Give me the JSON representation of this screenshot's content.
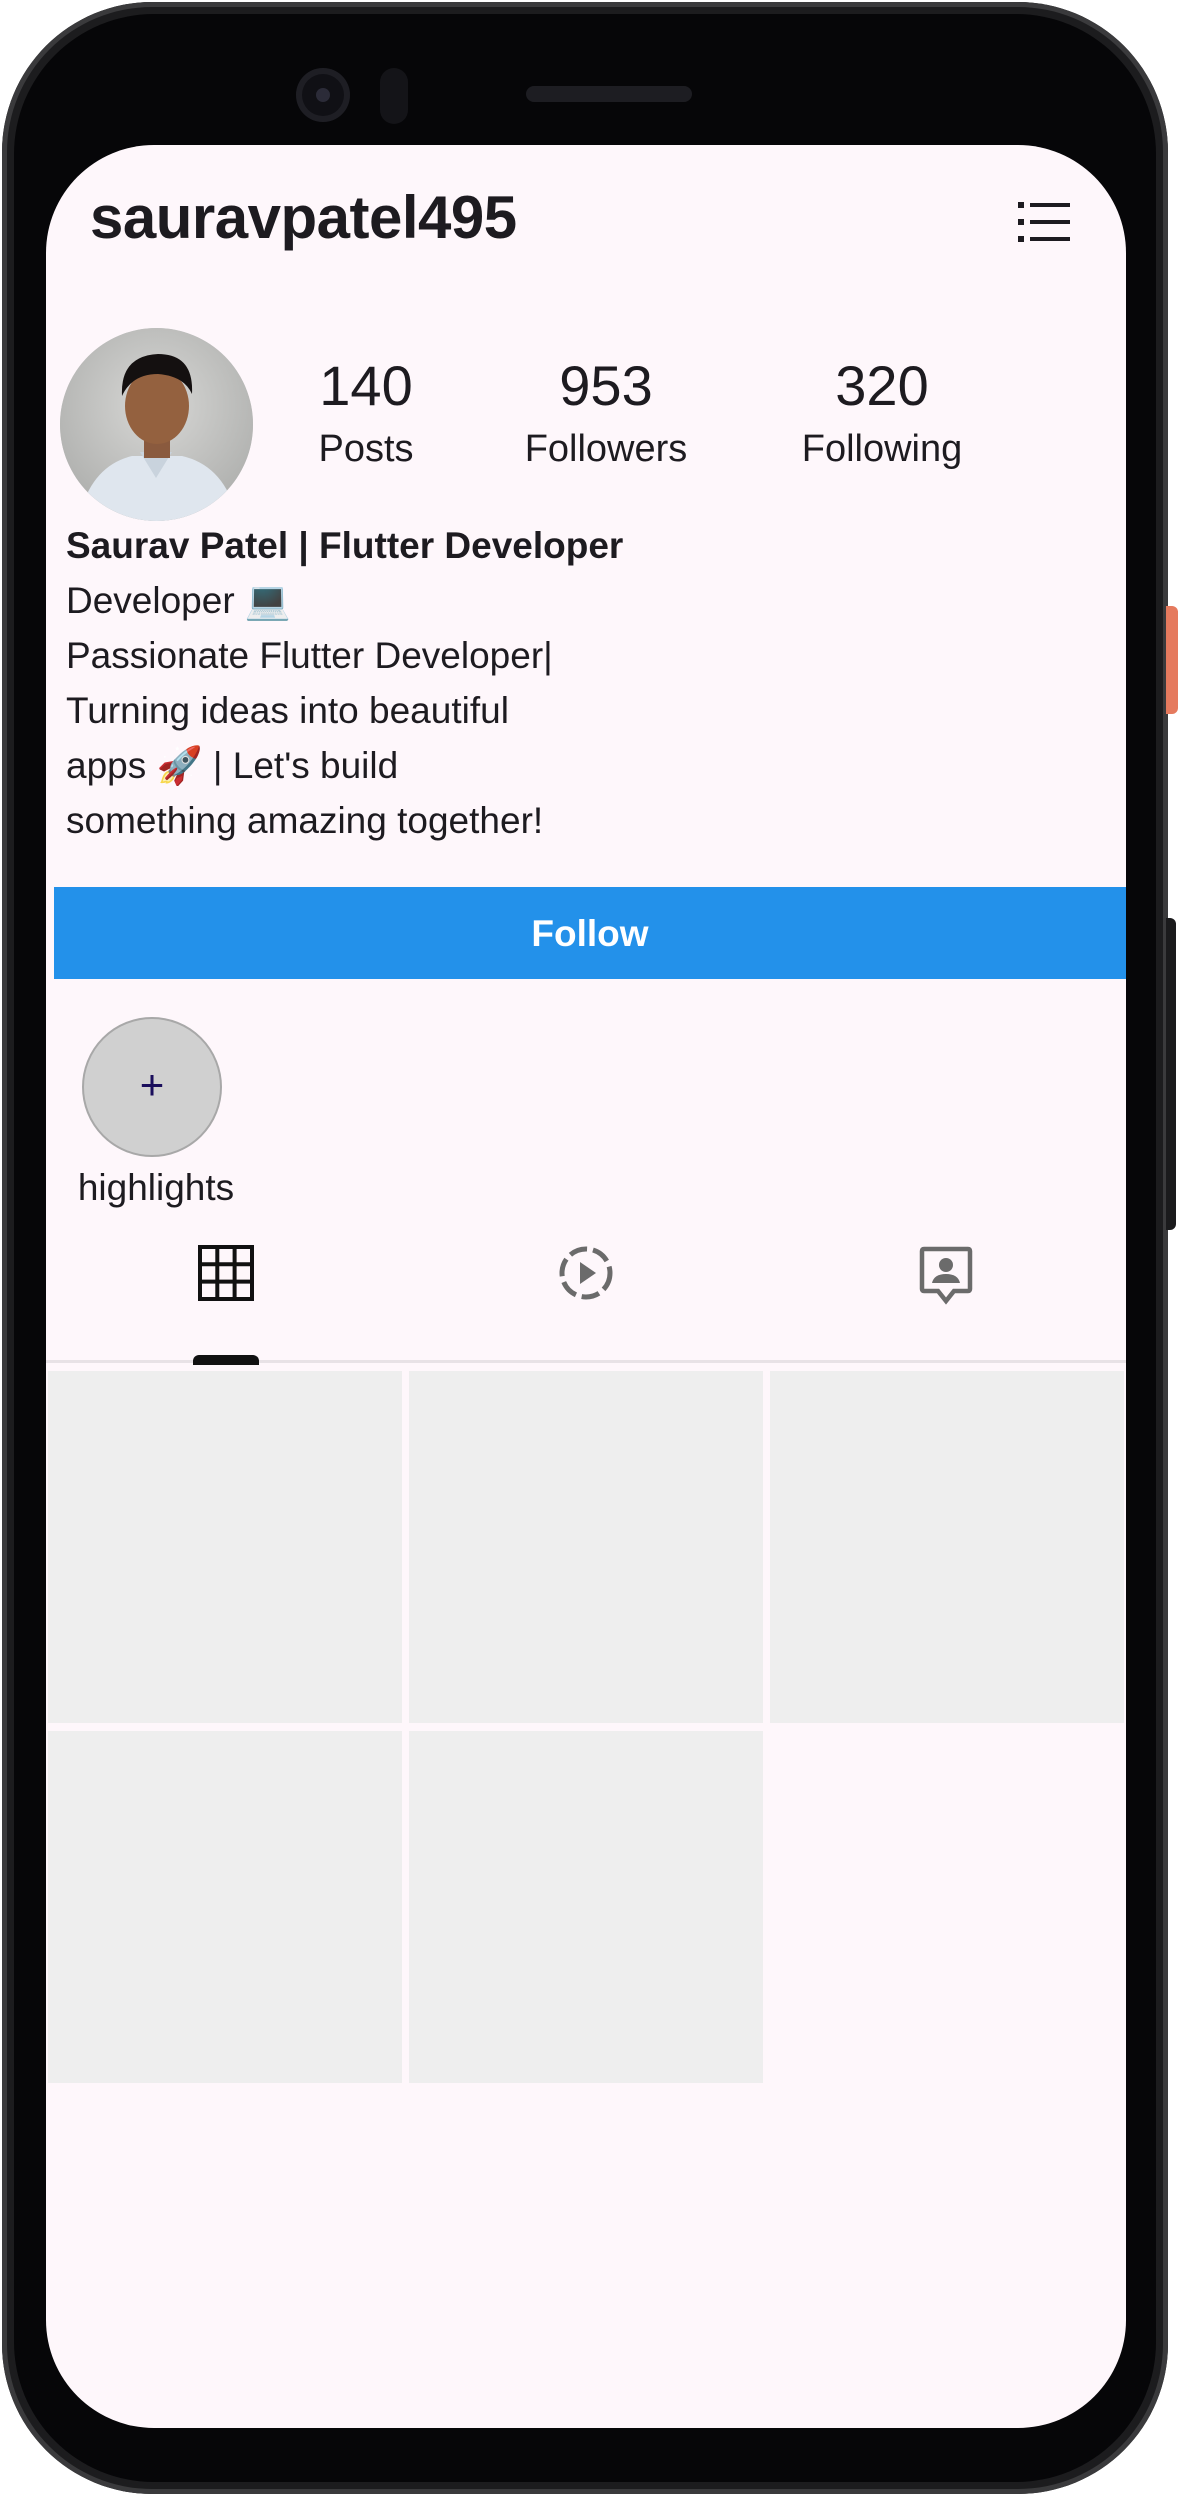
{
  "profile": {
    "username": "sauravpatel495",
    "stats": [
      {
        "value": "140",
        "label": "Posts"
      },
      {
        "value": "953",
        "label": "Followers"
      },
      {
        "value": "320",
        "label": "Following"
      }
    ],
    "display_name": "Saurav Patel | Flutter Developer",
    "bio_lines": [
      "Developer 💻",
      "Passionate Flutter Developer|",
      "Turning ideas into beautiful",
      "apps 🚀 | Let's build",
      "something amazing together!"
    ],
    "follow_label": "Follow"
  },
  "highlights": {
    "add_symbol": "+",
    "label": "highlights"
  },
  "tabs": [
    {
      "icon": "grid-icon",
      "selected": true
    },
    {
      "icon": "reels-icon",
      "selected": false
    },
    {
      "icon": "tagged-icon",
      "selected": false
    }
  ],
  "posts_count_shown": 5,
  "colors": {
    "accent": "#2391ea",
    "background": "#fef7fb",
    "placeholder": "#eeeeee"
  }
}
